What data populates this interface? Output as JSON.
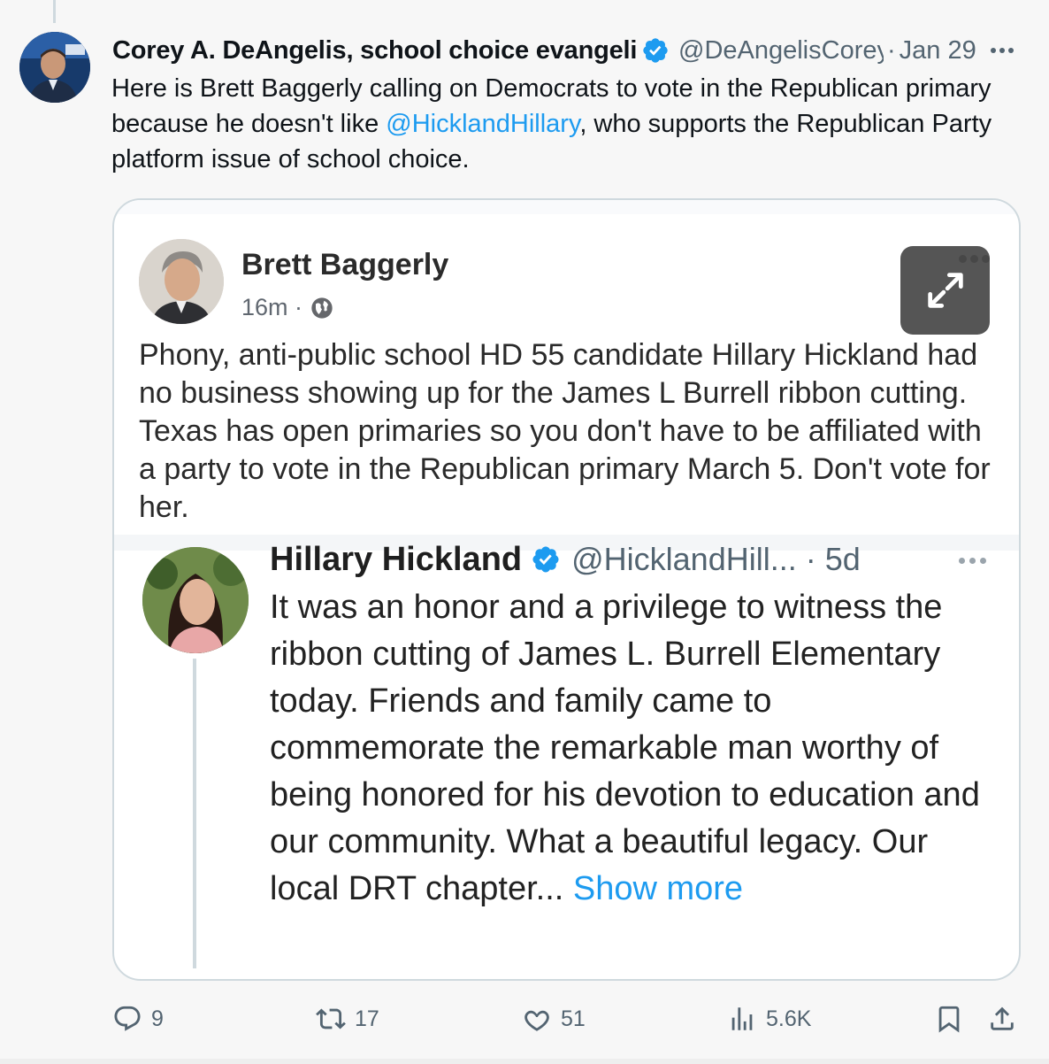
{
  "tweet": {
    "author_name": "Corey A. DeAngelis, school choice evangelist",
    "handle": "@DeAngelisCorey",
    "separator": "·",
    "date": "Jan 29",
    "text_before": "Here is Brett Baggerly calling on Democrats to vote in the Republican primary because he doesn't like ",
    "mention": "@HicklandHillary",
    "text_after": ", who supports the Republican Party platform issue of school choice."
  },
  "media": {
    "facebook_post": {
      "author": "Brett Baggerly",
      "time": "16m ·",
      "text": "Phony, anti-public school HD 55 candidate Hillary Hickland had no business showing up for the James L Burrell ribbon cutting. Texas has open primaries so you don't have to be affiliated with a party to vote in the Republican primary March 5. Don't vote for her."
    },
    "quoted_tweet": {
      "author": "Hillary Hickland",
      "handle_time": "@HicklandHill... · 5d",
      "text": "It was an honor and a privilege to witness the ribbon cutting of James L. Burrell Elementary today. Friends and family came to commemorate the remarkable man worthy of being honored for his devotion to education and our community. What a beautiful legacy. Our local DRT chapter... ",
      "show_more": "Show more"
    }
  },
  "actions": {
    "replies": "9",
    "reposts": "17",
    "likes": "51",
    "views": "5.6K"
  },
  "colors": {
    "accent": "#1d9bf0",
    "secondary_text": "#536471",
    "background": "#f7f7f7"
  },
  "icons": [
    "verified-badge-icon",
    "more-icon",
    "expand-icon",
    "globe-icon",
    "reply-icon",
    "repost-icon",
    "like-icon",
    "views-icon",
    "bookmark-icon",
    "share-icon"
  ]
}
